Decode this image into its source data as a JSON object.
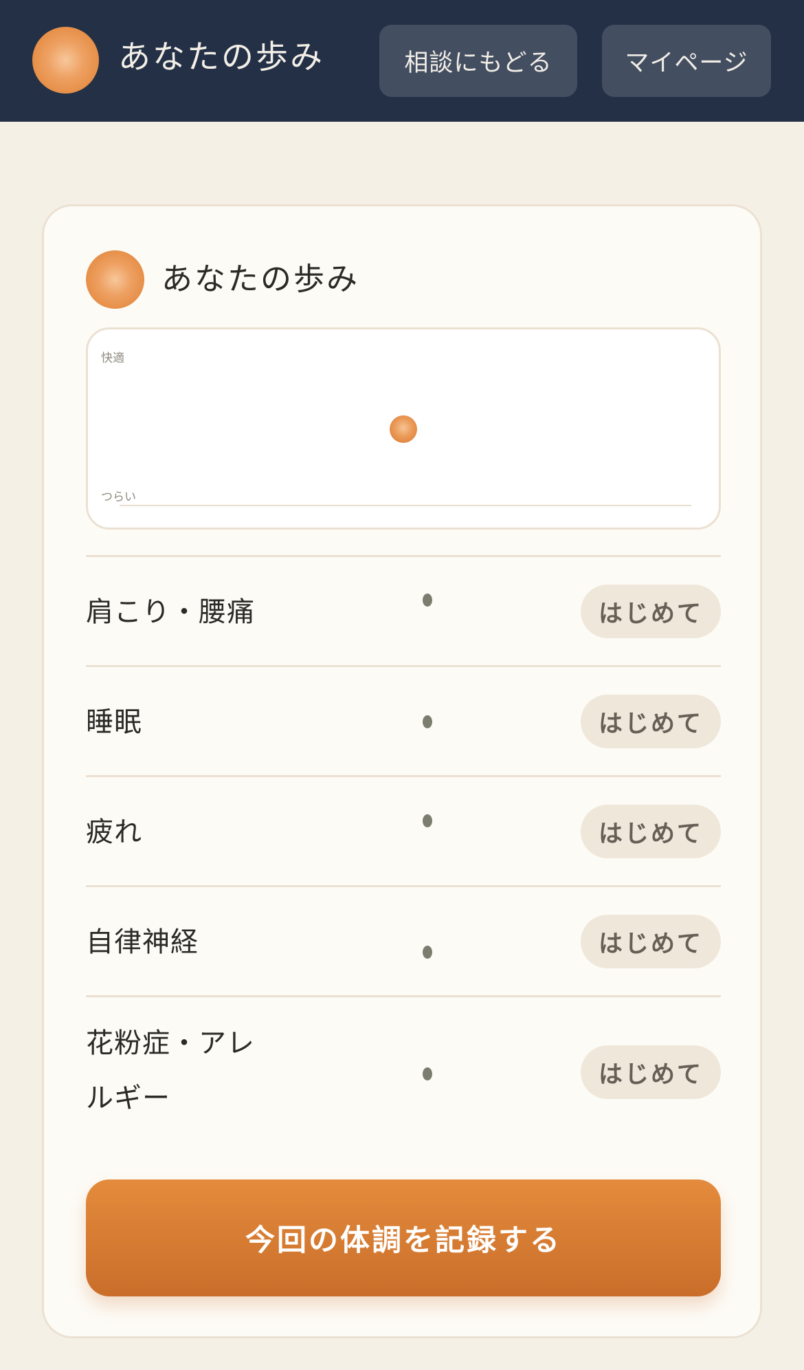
{
  "header": {
    "app_title": "あなたの歩み",
    "consult_back_label": "相談にもどる",
    "mypage_label": "マイページ"
  },
  "card": {
    "title": "あなたの歩み",
    "graph": {
      "label_top": "快適",
      "label_bottom": "つらい",
      "point_level": 0.5
    },
    "symptoms": [
      {
        "name": "肩こり・腰痛",
        "badge": "はじめて"
      },
      {
        "name": "睡眠",
        "badge": "はじめて"
      },
      {
        "name": "疲れ",
        "badge": "はじめて"
      },
      {
        "name": "自律神経",
        "badge": "はじめて"
      },
      {
        "name": "花粉症・アレルギー",
        "badge": "はじめて"
      }
    ],
    "record_button_label": "今回の体調を記録する"
  },
  "colors": {
    "header_bg": "#233046",
    "accent": "#d9782e",
    "page_bg": "#f5f0e6"
  }
}
